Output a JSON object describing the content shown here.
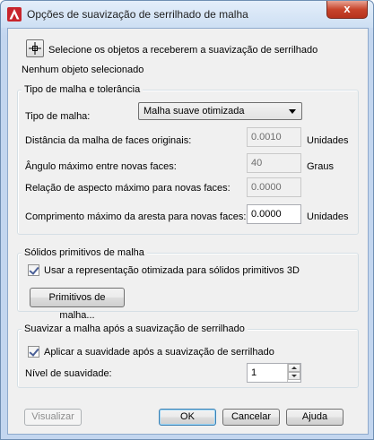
{
  "window": {
    "title": "Opções de suavização de serrilhado de malha",
    "close_glyph": "x",
    "icon": "autocad-icon"
  },
  "selection": {
    "pick_label": "Selecione os objetos a receberem a suavização de serrilhado",
    "status": "Nenhum objeto selecionado",
    "pick_icon": "crosshair-icon"
  },
  "mesh_group": {
    "title": "Tipo de malha e tolerância",
    "type_label": "Tipo de malha:",
    "type_value": "Malha suave otimizada",
    "distance_label": "Distância da malha de faces originais:",
    "distance_value": "0.0010",
    "distance_unit": "Unidades",
    "angle_label": "Ângulo máximo entre novas faces:",
    "angle_value": "40",
    "angle_unit": "Graus",
    "aspect_label": "Relação de aspecto máximo para novas faces:",
    "aspect_value": "0.0000",
    "edge_label": "Comprimento máximo da aresta para novas faces:",
    "edge_value": "0.0000",
    "edge_unit": "Unidades"
  },
  "primitives_group": {
    "title": "Sólidos primitivos de malha",
    "checkbox_label": "Usar a representação otimizada para sólidos primitivos 3D",
    "checked": true,
    "button_label": "Primitivos de malha..."
  },
  "smooth_group": {
    "title": "Suavizar a malha após a suavização de serrilhado",
    "checkbox_label": "Aplicar a suavidade após a suavização de serrilhado",
    "checked": true,
    "level_label": "Nível de suavidade:",
    "level_value": "1"
  },
  "footer": {
    "preview_label": "Visualizar",
    "ok_label": "OK",
    "cancel_label": "Cancelar",
    "help_label": "Ajuda"
  }
}
